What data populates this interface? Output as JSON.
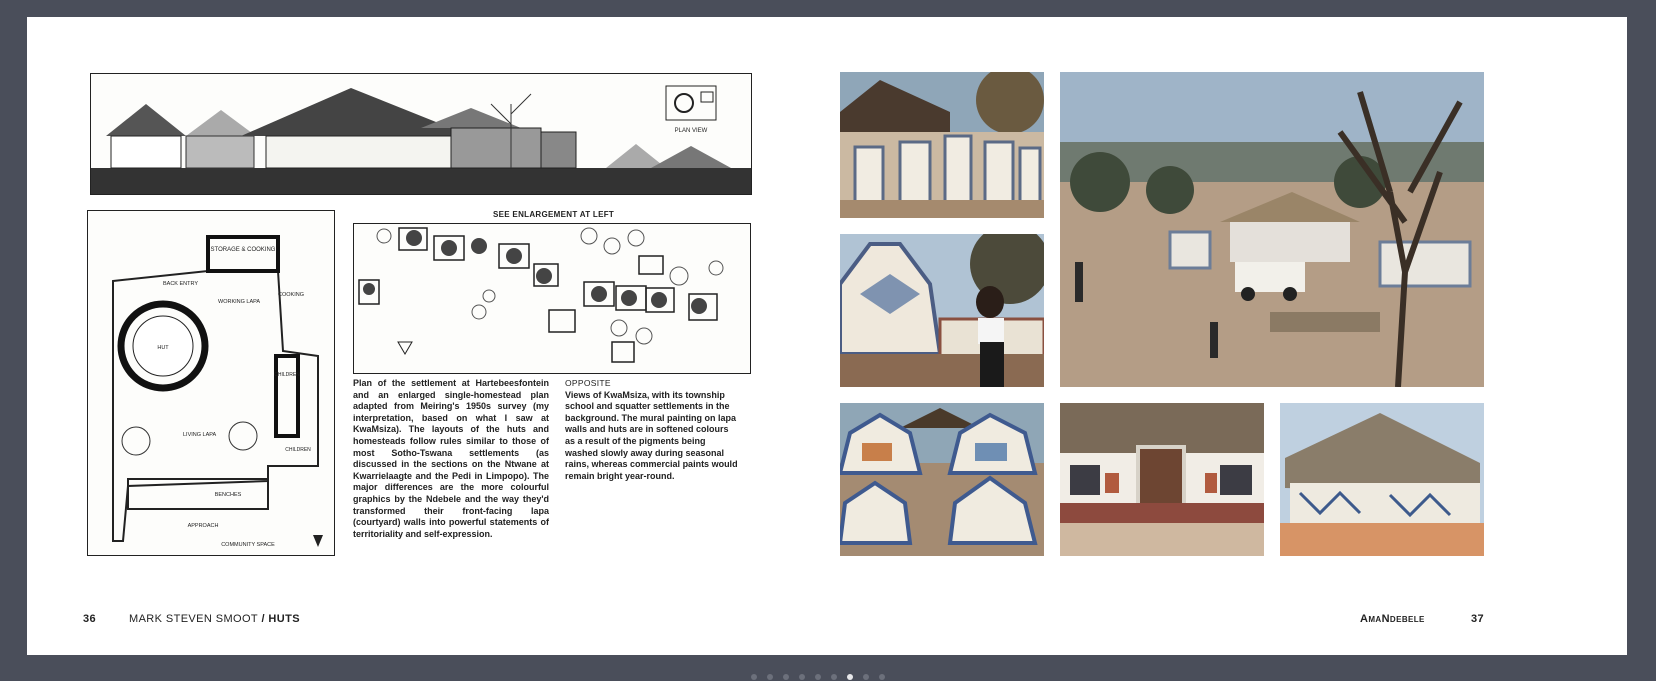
{
  "left_page": {
    "see_enlargement": "SEE ENLARGEMENT AT LEFT",
    "drawing_labels": {
      "plan_view": "PLAN VIEW",
      "storage": "STORAGE & COOKING",
      "back_entry": "BACK ENTRY",
      "working_lapa": "WORKING LAPA",
      "cooking": "COOKING",
      "hut": "HUT",
      "children": "CHILDREN",
      "living_lapa": "LIVING LAPA",
      "children2": "CHILDREN",
      "benches": "BENCHES",
      "approach": "APPROACH",
      "community_space": "COMMUNITY SPACE"
    },
    "caption": "Plan of the settlement at Hartebeesfontein and an enlarged single-homestead plan adapted from Meiring's 1950s survey (my interpretation, based on what I saw at KwaMsiza). The layouts of the huts and homesteads follow rules similar to those of most Sotho-Tswana settlements (as discussed in the sections on the Ntwane at Kwarrielaagte and the Pedi in Limpopo). The major differences are the more colourful graphics by the Ndebele and the way they'd transformed their front-facing lapa (courtyard) walls into powerful statements of territoriality and self-expression.",
    "opposite_label": "OPPOSITE",
    "opposite_caption": "Views of KwaMsiza, with its township school and squatter settlements in the background. The mural painting on lapa walls and huts are in softened colours as a result of the pigments being washed slowly away during seasonal rains, whereas commercial paints would remain bright year-round.",
    "page_number": "36",
    "author": "MARK STEVEN SMOOT",
    "separator": " / ",
    "book_title": "HUTS"
  },
  "right_page": {
    "section_title": "AmaNdebele",
    "page_number": "37"
  },
  "pagination": {
    "count": 9,
    "active": 6
  },
  "colors": {
    "background": "#4a4e5a",
    "page": "#ffffff",
    "ink": "#222222"
  }
}
